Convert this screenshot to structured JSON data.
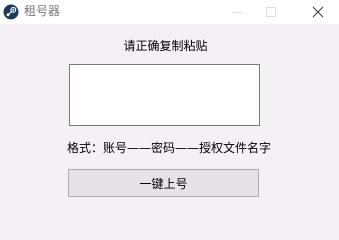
{
  "window": {
    "title": "租号器",
    "icon": "steam-logo-icon",
    "controls": [
      "minimize-icon",
      "maximize-icon",
      "close-icon"
    ]
  },
  "main": {
    "instruction": "请正确复制粘贴",
    "paste_input": {
      "value": "",
      "placeholder": ""
    },
    "format_hint": "格式：账号——密码——授权文件名字",
    "login_button": "一键上号"
  },
  "colors": {
    "window_bg": "#f5f0f5",
    "titlebar_bg": "#ffffff",
    "button_bg": "#e7e2e7",
    "border": "#7a7a7a"
  }
}
